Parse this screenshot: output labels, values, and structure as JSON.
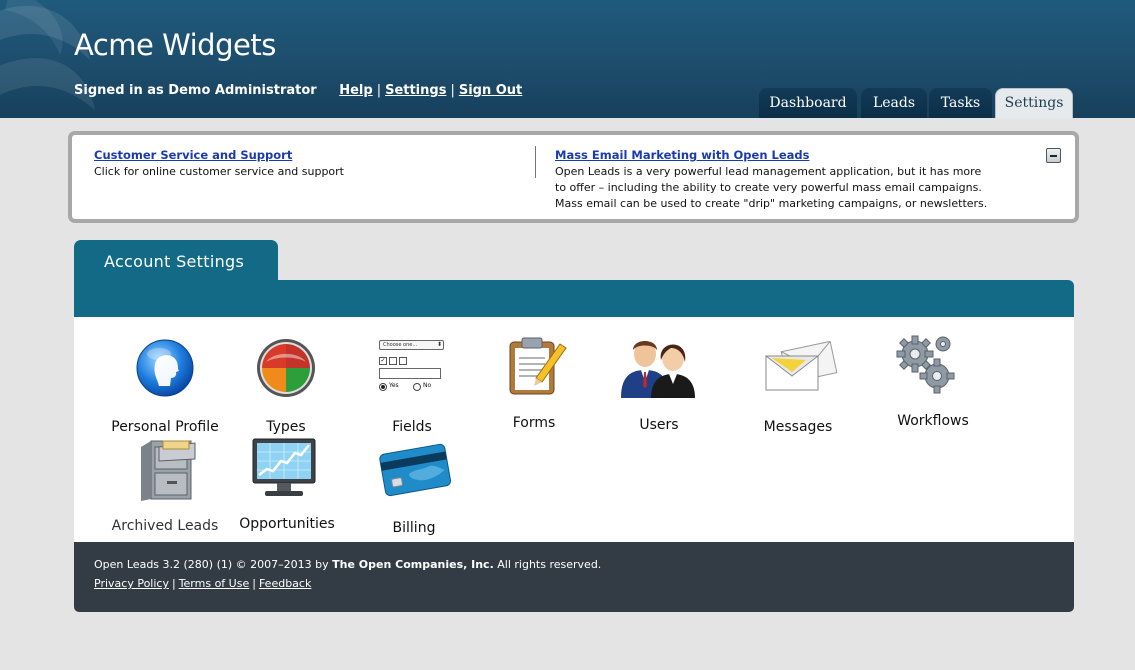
{
  "header": {
    "app_title": "Acme Widgets",
    "signed_in": "Signed in as Demo Administrator",
    "links": [
      "Help",
      "Settings",
      "Sign Out"
    ],
    "separator": "|"
  },
  "nav": {
    "tabs": [
      {
        "label": "Dashboard",
        "active": false
      },
      {
        "label": "Leads",
        "active": false
      },
      {
        "label": "Tasks",
        "active": false
      },
      {
        "label": "Settings",
        "active": true
      }
    ]
  },
  "promo": {
    "left": {
      "title": "Customer Service and Support",
      "text": "Click for online customer service and support"
    },
    "right": {
      "title": "Mass Email Marketing with Open Leads",
      "lines": [
        "Open Leads is a very powerful lead management application, but it has more",
        "to offer – including the ability to create very powerful mass email campaigns.",
        "Mass email can be used to create \"drip\" marketing campaigns, or newsletters."
      ]
    }
  },
  "settings": {
    "tab_label": "Account Settings",
    "items": [
      {
        "label": "Personal Profile",
        "icon": "person-head-icon"
      },
      {
        "label": "Types",
        "icon": "color-wheel-icon"
      },
      {
        "label": "Fields",
        "icon": "form-fields-icon"
      },
      {
        "label": "Forms",
        "icon": "clipboard-icon"
      },
      {
        "label": "Users",
        "icon": "users-icon"
      },
      {
        "label": "Messages",
        "icon": "envelopes-icon"
      },
      {
        "label": "Workflows",
        "icon": "gears-icon"
      },
      {
        "label": "Archived Leads",
        "icon": "file-cabinet-icon"
      },
      {
        "label": "Opportunities",
        "icon": "chart-monitor-icon"
      },
      {
        "label": "Billing",
        "icon": "credit-card-icon"
      }
    ],
    "fields_icon": {
      "select_text": "Choose one...",
      "radio_yes": "Yes",
      "radio_no": "No"
    }
  },
  "footer": {
    "version": "Open Leads 3.2 (280) (1) © 2007–2013 by ",
    "company": "The Open Companies, Inc.",
    "rights": " All rights reserved.",
    "links": [
      "Privacy Policy",
      "Terms of Use",
      "Feedback"
    ],
    "separator": "|"
  },
  "colors": {
    "header": "#1d4d6c",
    "panel_teal": "#136a86",
    "footer": "#333c45",
    "link_blue": "#1a3bb0"
  }
}
